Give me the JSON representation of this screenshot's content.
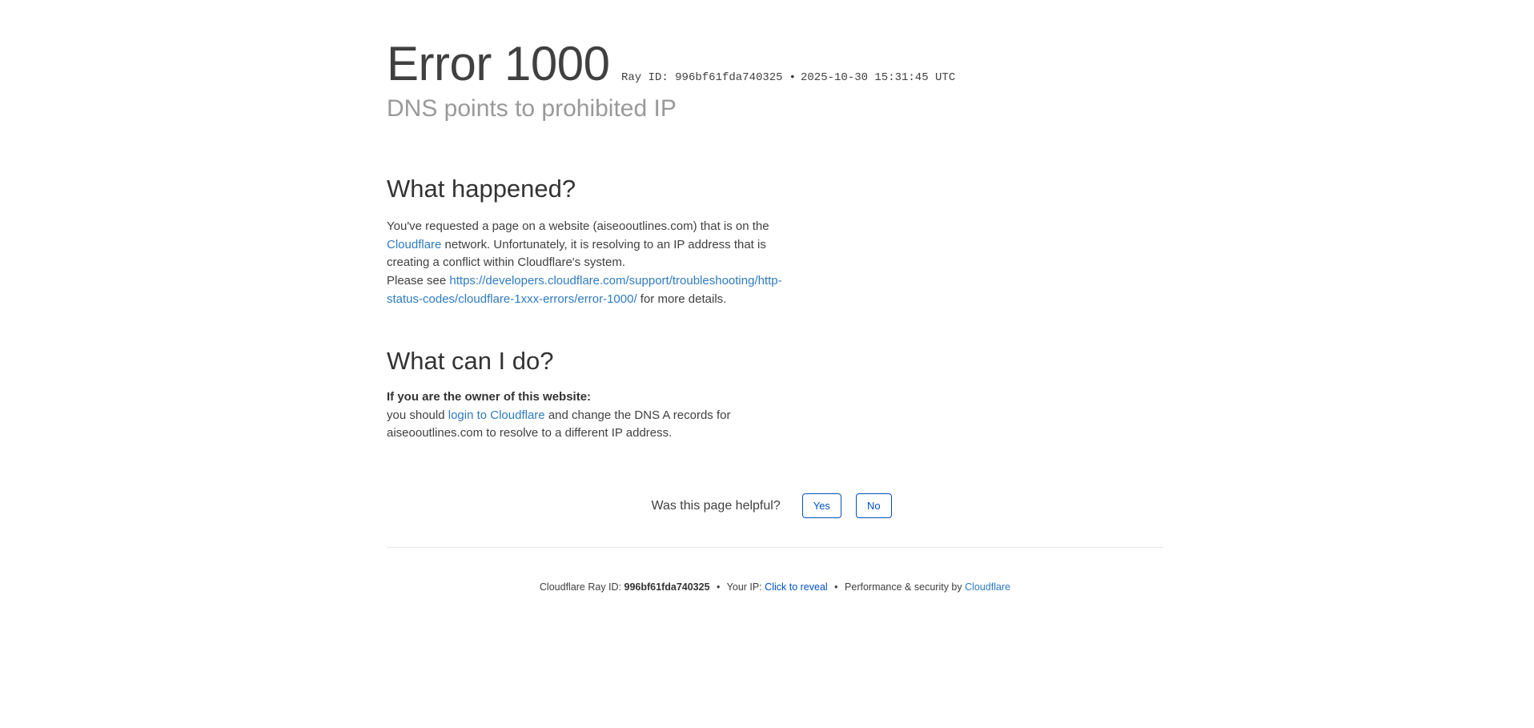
{
  "header": {
    "error_code": "Error 1000",
    "ray_label": "Ray ID: 996bf61fda740325",
    "timestamp": "2025-10-30 15:31:45 UTC",
    "subtitle": "DNS points to prohibited IP"
  },
  "what_happened": {
    "heading": "What happened?",
    "text_1": "You've requested a page on a website (aiseooutlines.com) that is on the ",
    "cloudflare_link": "Cloudflare",
    "text_2": " network. Unfortunately, it is resolving to an IP address that is creating a conflict within Cloudflare's system.",
    "text_3": "Please see ",
    "docs_link": "https://developers.cloudflare.com/support/troubleshooting/http-status-codes/cloudflare-1xxx-errors/error-1000/",
    "text_4": " for more details."
  },
  "what_can_i_do": {
    "heading": "What can I do?",
    "owner_label": "If you are the owner of this website:",
    "text_1": "you should ",
    "login_link": "login to Cloudflare",
    "text_2": " and change the DNS A records for aiseooutlines.com to resolve to a different IP address."
  },
  "feedback": {
    "question": "Was this page helpful?",
    "yes_label": "Yes",
    "no_label": "No"
  },
  "footer": {
    "ray_label": "Cloudflare Ray ID: ",
    "ray_id": "996bf61fda740325",
    "bullet_1": "•",
    "ip_label": "Your IP: ",
    "reveal_link": "Click to reveal",
    "bullet_2": "•",
    "perf_label": "Performance & security by ",
    "cloudflare_link": "Cloudflare"
  },
  "colors": {
    "link": "#2f7bbf",
    "button": "#0051c3",
    "subtitle": "#999999",
    "text": "#404040"
  }
}
